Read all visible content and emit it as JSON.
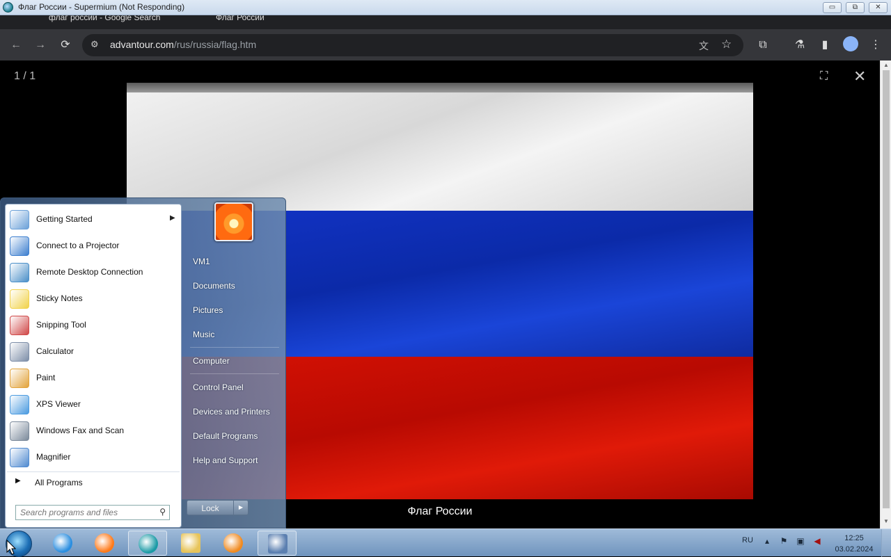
{
  "window": {
    "title": "Флаг России - Supermium (Not Responding)",
    "controls": {
      "minimize": "▭",
      "restore": "⧉",
      "close": "✕"
    }
  },
  "tabs": [
    {
      "label": "флаг россии - Google Search"
    },
    {
      "label": "Флаг России"
    }
  ],
  "toolbar": {
    "url_host": "advantour.com",
    "url_path": "/rus/russia/flag.htm"
  },
  "viewer": {
    "counter": "1 / 1",
    "caption": "Флаг России",
    "flag_colors": {
      "white": "#f1f1f1",
      "blue": "#1334c8",
      "red": "#d81204"
    }
  },
  "start_menu": {
    "programs": [
      {
        "label": "Getting Started",
        "icon": "getting-started-icon",
        "submenu": true
      },
      {
        "label": "Connect to a Projector",
        "icon": "projector-icon"
      },
      {
        "label": "Remote Desktop Connection",
        "icon": "remote-desktop-icon"
      },
      {
        "label": "Sticky Notes",
        "icon": "sticky-notes-icon"
      },
      {
        "label": "Snipping Tool",
        "icon": "snipping-tool-icon"
      },
      {
        "label": "Calculator",
        "icon": "calculator-icon"
      },
      {
        "label": "Paint",
        "icon": "paint-icon"
      },
      {
        "label": "XPS Viewer",
        "icon": "xps-viewer-icon"
      },
      {
        "label": "Windows Fax and Scan",
        "icon": "fax-scan-icon"
      },
      {
        "label": "Magnifier",
        "icon": "magnifier-icon"
      }
    ],
    "all_programs": "All Programs",
    "search_placeholder": "Search programs and files",
    "places": [
      {
        "label": "VM1"
      },
      {
        "label": "Documents"
      },
      {
        "label": "Pictures"
      },
      {
        "label": "Music"
      },
      {
        "label": "Computer"
      },
      {
        "label": "Control Panel"
      },
      {
        "label": "Devices and Printers"
      },
      {
        "label": "Default Programs"
      },
      {
        "label": "Help and Support"
      }
    ],
    "lock_label": "Lock"
  },
  "taskbar": {
    "apps": [
      {
        "name": "internet-explorer-icon",
        "color": "#2a8ee0"
      },
      {
        "name": "firefox-icon",
        "color": "#ff7a1a"
      },
      {
        "name": "supermium-icon",
        "color": "#1a9aa5"
      },
      {
        "name": "explorer-folder-icon",
        "color": "#e7c45a"
      },
      {
        "name": "media-player-icon",
        "color": "#f08a20"
      },
      {
        "name": "keyboard-app-icon",
        "color": "#5b7fb0"
      }
    ],
    "language": "RU",
    "time": "12:25",
    "date": "03.02.2024"
  }
}
